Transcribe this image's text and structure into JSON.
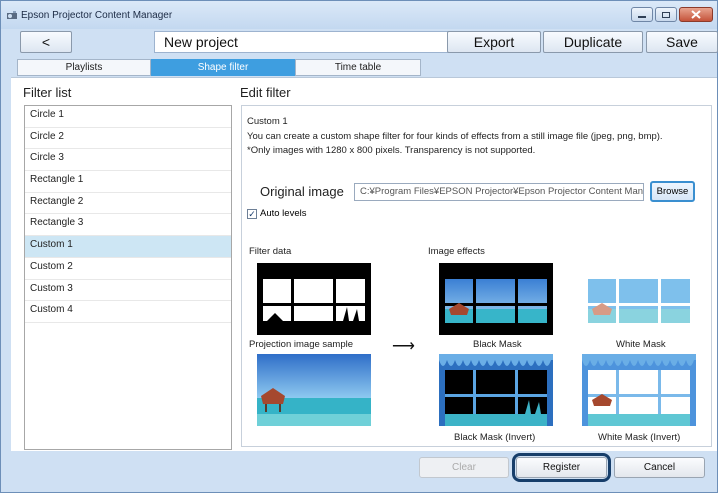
{
  "window": {
    "title": "Epson Projector Content Manager"
  },
  "toolbar": {
    "back_label": "<",
    "project_name": "New project",
    "export_label": "Export",
    "duplicate_label": "Duplicate",
    "save_label": "Save"
  },
  "tabs": [
    {
      "label": "Playlists",
      "active": false
    },
    {
      "label": "Shape filter",
      "active": true
    },
    {
      "label": "Time table",
      "active": false
    }
  ],
  "filter_list": {
    "heading": "Filter list",
    "items": [
      "Circle 1",
      "Circle 2",
      "Circle 3",
      "Rectangle 1",
      "Rectangle 2",
      "Rectangle 3",
      "Custom 1",
      "Custom 2",
      "Custom 3",
      "Custom 4"
    ],
    "selected": "Custom 1"
  },
  "edit_filter": {
    "heading": "Edit filter",
    "name": "Custom 1",
    "description_1": "You can create a custom shape filter for four kinds of effects from a still image file (jpeg, png, bmp).",
    "description_2": "*Only images with 1280 x 800 pixels. Transparency is not supported.",
    "original_image_label": "Original image",
    "original_image_path": "C:¥Program Files¥EPSON Projector¥Epson Projector Content Mana",
    "browse_label": "Browse",
    "auto_levels_label": "Auto levels",
    "auto_levels_checked": true,
    "filter_data_label": "Filter data",
    "image_effects_label": "Image effects",
    "projection_sample_label": "Projection image sample",
    "black_mask_label": "Black Mask",
    "white_mask_label": "White Mask",
    "black_mask_invert_label": "Black Mask (Invert)",
    "white_mask_invert_label": "White Mask (Invert)"
  },
  "actions": {
    "clear_label": "Clear",
    "register_label": "Register",
    "cancel_label": "Cancel"
  },
  "colors": {
    "accent": "#3e9ee0",
    "window_bg": "#cfe0f3",
    "selection": "#cde6f4",
    "highlight_ring": "#173e6a"
  }
}
